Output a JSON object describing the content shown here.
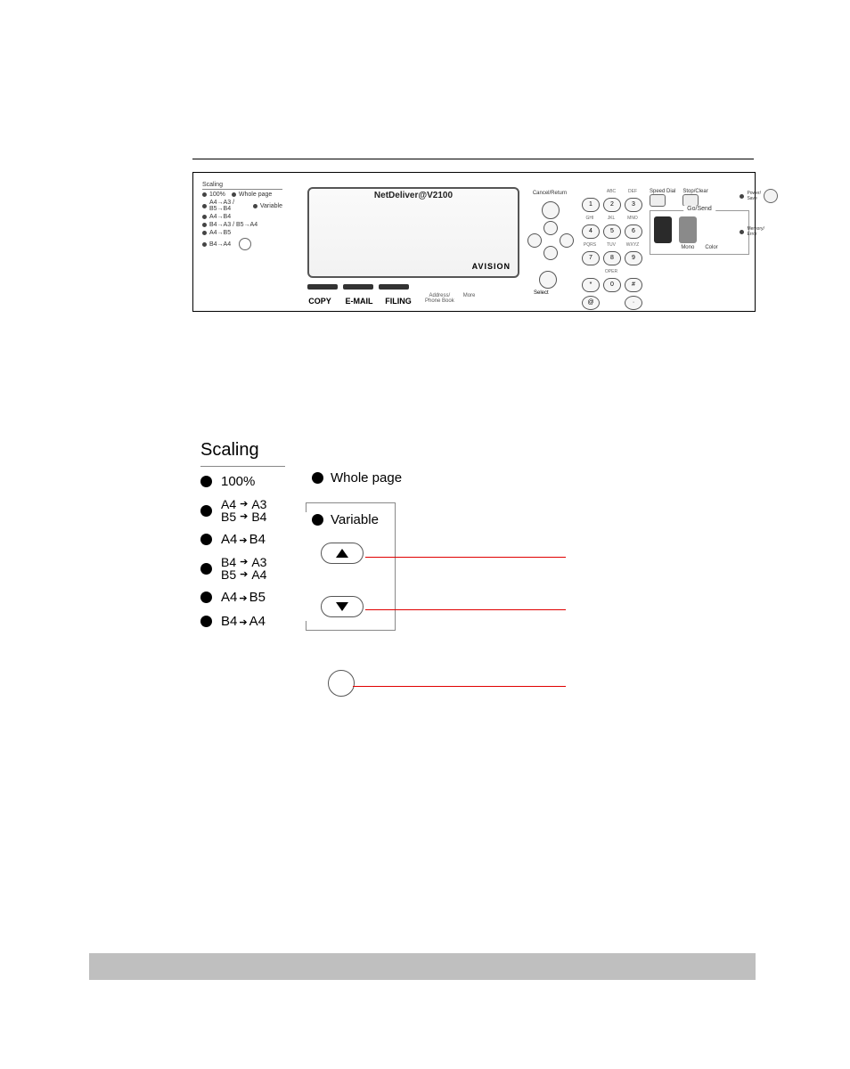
{
  "panel": {
    "screen": {
      "title": "NetDeliver@V2100",
      "brand": "AVISION"
    },
    "mini_scaling_title": "Scaling",
    "mini_scaling": [
      "100%",
      "A4→A3 / B5→B4",
      "A4→B4",
      "B4→A3 / B5→A4",
      "A4→B5",
      "B4→A4"
    ],
    "mini_scaling_right": {
      "whole": "Whole page",
      "variable": "Variable"
    },
    "modes": {
      "copy": "COPY",
      "email": "E-MAIL",
      "filing": "FILING"
    },
    "small_labels": {
      "addrbook": "Address/\nPhone Book",
      "more": "More"
    },
    "nav": {
      "cancel": "Cancel/Return",
      "select": "Select"
    },
    "keypad": {
      "subs": [
        "",
        "ABC",
        "DEF",
        "GHI",
        "JKL",
        "MNO",
        "PQRS",
        "TUV",
        "WXYZ",
        "",
        "OPER",
        ""
      ],
      "keys": [
        "1",
        "2",
        "3",
        "4",
        "5",
        "6",
        "7",
        "8",
        "9",
        "*",
        "0",
        "#"
      ],
      "extra": [
        "@",
        "·"
      ]
    },
    "right": {
      "speed": "Speed Dial",
      "stop": "Stop/Clear",
      "gosend": "Go/Send",
      "mono": "Mono",
      "color": "Color",
      "led1": "Power/\nSave",
      "led2": "Memory/\nError"
    }
  },
  "scaling": {
    "title": "Scaling",
    "items": {
      "i100": "100%",
      "a4a3": "A4",
      "a4a3b": "A3",
      "b5b4": "B5",
      "b5b4b": "B4",
      "a4b4a": "A4",
      "a4b4b": "B4",
      "b4a3a": "B4",
      "b4a3b": "A3",
      "b5a4a": "B5",
      "b5a4b": "A4",
      "a4b5a": "A4",
      "a4b5b": "B5",
      "b4a4a": "B4",
      "b4a4b": "A4",
      "whole": "Whole page",
      "variable": "Variable"
    }
  }
}
